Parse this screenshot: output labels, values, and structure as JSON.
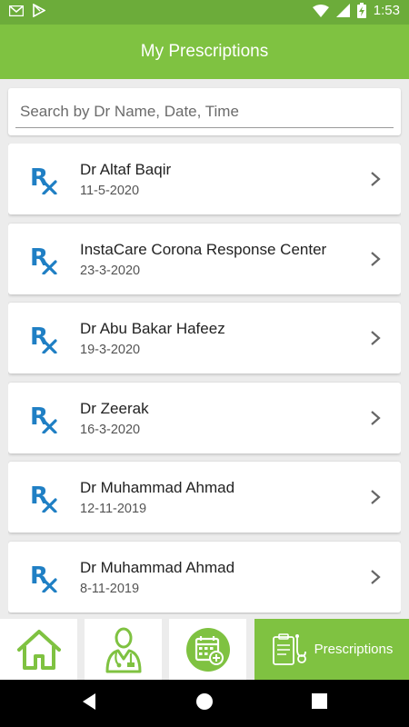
{
  "status_bar": {
    "time": "1:53",
    "icons": [
      "gmail-icon",
      "play-store-icon",
      "wifi-icon",
      "cellular-icon",
      "battery-charging-icon"
    ]
  },
  "app_bar": {
    "title": "My Prescriptions"
  },
  "search": {
    "placeholder": "Search by Dr Name, Date, Time",
    "value": ""
  },
  "prescriptions": [
    {
      "doctor": "Dr Altaf Baqir",
      "date": "11-5-2020"
    },
    {
      "doctor": "InstaCare Corona Response Center",
      "date": "23-3-2020"
    },
    {
      "doctor": "Dr Abu Bakar Hafeez",
      "date": "19-3-2020"
    },
    {
      "doctor": "Dr Zeerak",
      "date": "16-3-2020"
    },
    {
      "doctor": "Dr Muhammad Ahmad",
      "date": "12-11-2019"
    },
    {
      "doctor": "Dr Muhammad Ahmad",
      "date": "8-11-2019"
    }
  ],
  "bottom_nav": {
    "items": [
      {
        "icon": "home-icon"
      },
      {
        "icon": "doctor-icon"
      },
      {
        "icon": "calendar-icon"
      },
      {
        "icon": "prescription-icon",
        "label": "Prescriptions",
        "active": true
      }
    ]
  },
  "colors": {
    "primary": "#7fc241",
    "status_bar": "#6cac3a",
    "rx_icon": "#1f7fc4"
  }
}
